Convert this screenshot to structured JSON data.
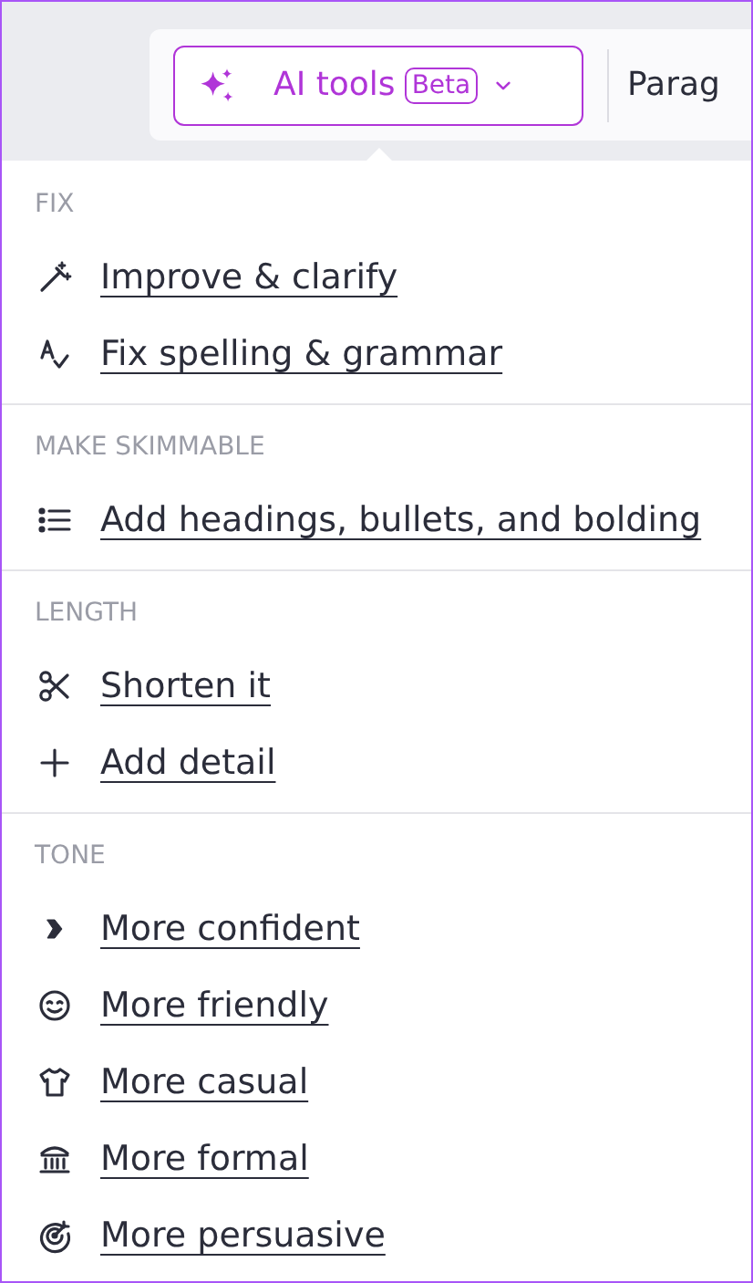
{
  "toolbar": {
    "ai_button": {
      "label": "AI tools",
      "badge": "Beta"
    },
    "next_item": "Parag"
  },
  "sections": [
    {
      "title": "FIX",
      "items": [
        {
          "label": "Improve & clarify"
        },
        {
          "label": "Fix spelling & grammar"
        }
      ]
    },
    {
      "title": "MAKE SKIMMABLE",
      "items": [
        {
          "label": "Add headings, bullets, and bolding"
        }
      ]
    },
    {
      "title": "LENGTH",
      "items": [
        {
          "label": "Shorten it"
        },
        {
          "label": "Add detail"
        }
      ]
    },
    {
      "title": "TONE",
      "items": [
        {
          "label": "More confident"
        },
        {
          "label": "More friendly"
        },
        {
          "label": "More casual"
        },
        {
          "label": "More formal"
        },
        {
          "label": "More persuasive"
        }
      ]
    }
  ]
}
